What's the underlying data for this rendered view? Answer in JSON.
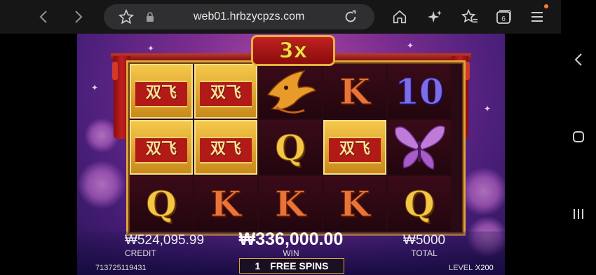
{
  "browser": {
    "url": "web01.hrbzycpzs.com",
    "tab_count": "6",
    "icons": [
      "back-icon",
      "forward-icon",
      "star-icon",
      "lock-icon",
      "reload-icon",
      "home-icon",
      "sparkle-icon",
      "favorites-icon",
      "tabs-icon",
      "menu-icon"
    ]
  },
  "game": {
    "multiplier": "3x",
    "tile_chars": "双飞",
    "reels": [
      [
        "tile",
        "tile",
        "Q"
      ],
      [
        "tile",
        "tile",
        "K"
      ],
      [
        "bird",
        "Q",
        "K"
      ],
      [
        "K",
        "tile",
        "K"
      ],
      [
        "10",
        "butterfly",
        "Q"
      ]
    ],
    "credit_value": "₩524,095.99",
    "credit_label": "CREDIT",
    "win_value": "₩336,000.00",
    "win_label": "WIN",
    "total_value": "₩5000",
    "total_label": "TOTAL",
    "free_spins_count": "1",
    "free_spins_label": "FREE SPINS",
    "session_id": "713725119431",
    "level_label": "LEVEL :",
    "level_value": "X200"
  },
  "colors": {
    "accent_gold": "#e0a33a",
    "red": "#c22020"
  }
}
